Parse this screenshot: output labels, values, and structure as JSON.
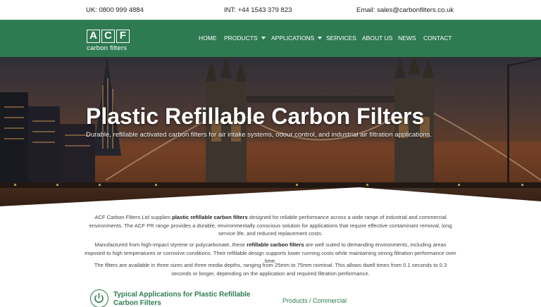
{
  "topbar": {
    "uk_phone": "UK: 0800 999 4884",
    "int_phone": "INT: +44 1543 379 823",
    "email_label": "Email:",
    "email": "sales@carbonfilters.co.uk"
  },
  "logo": {
    "letters": [
      "A",
      "C",
      "F"
    ],
    "tagline": "carbon filters"
  },
  "nav": {
    "items": [
      {
        "label": "HOME",
        "dropdown": false
      },
      {
        "label": "PRODUCTS",
        "dropdown": true
      },
      {
        "label": "APPLICATIONS",
        "dropdown": true
      },
      {
        "label": "SERVICES",
        "dropdown": false
      },
      {
        "label": "ABOUT US",
        "dropdown": false
      },
      {
        "label": "NEWS",
        "dropdown": false
      },
      {
        "label": "CONTACT",
        "dropdown": false
      }
    ]
  },
  "hero": {
    "title": "Plastic Refillable Carbon Filters",
    "subtitle": "Durable, refillable activated carbon filters for air intake systems, odour control, and industrial air filtration applications."
  },
  "intro": {
    "p1": {
      "a": "ACF Carbon Filters Ltd supplies ",
      "b": "plastic refillable carbon filters",
      "c": " designed for reliable performance across a wide range of industrial and commercial environments. The ACF PR range provides a durable, environmentally conscious solution for applications that require effective contaminant removal, long service life, and reduced replacement costs."
    },
    "p2": {
      "a": "Manufactured from high-impact styrene or polycarbonate, these ",
      "b": "refillable carbon filters",
      "c": " are well suited to demanding environments, including areas exposed to high temperatures or corrosive conditions. Their refillable design supports lower running costs while maintaining strong filtration performance over time."
    },
    "p3": "The filters are available in three sizes and three media depths, ranging from 25mm to 75mm nominal. This allows dwell times from 0.1 seconds to 0.3 seconds or longer, depending on the application and required filtration performance."
  },
  "applications": {
    "icon": "power-icon",
    "title": "Typical Applications for Plastic Refillable Carbon Filters",
    "first_item": "Products / Commercial"
  },
  "colors": {
    "brand_green": "#2e7a51",
    "white": "#ffffff"
  }
}
